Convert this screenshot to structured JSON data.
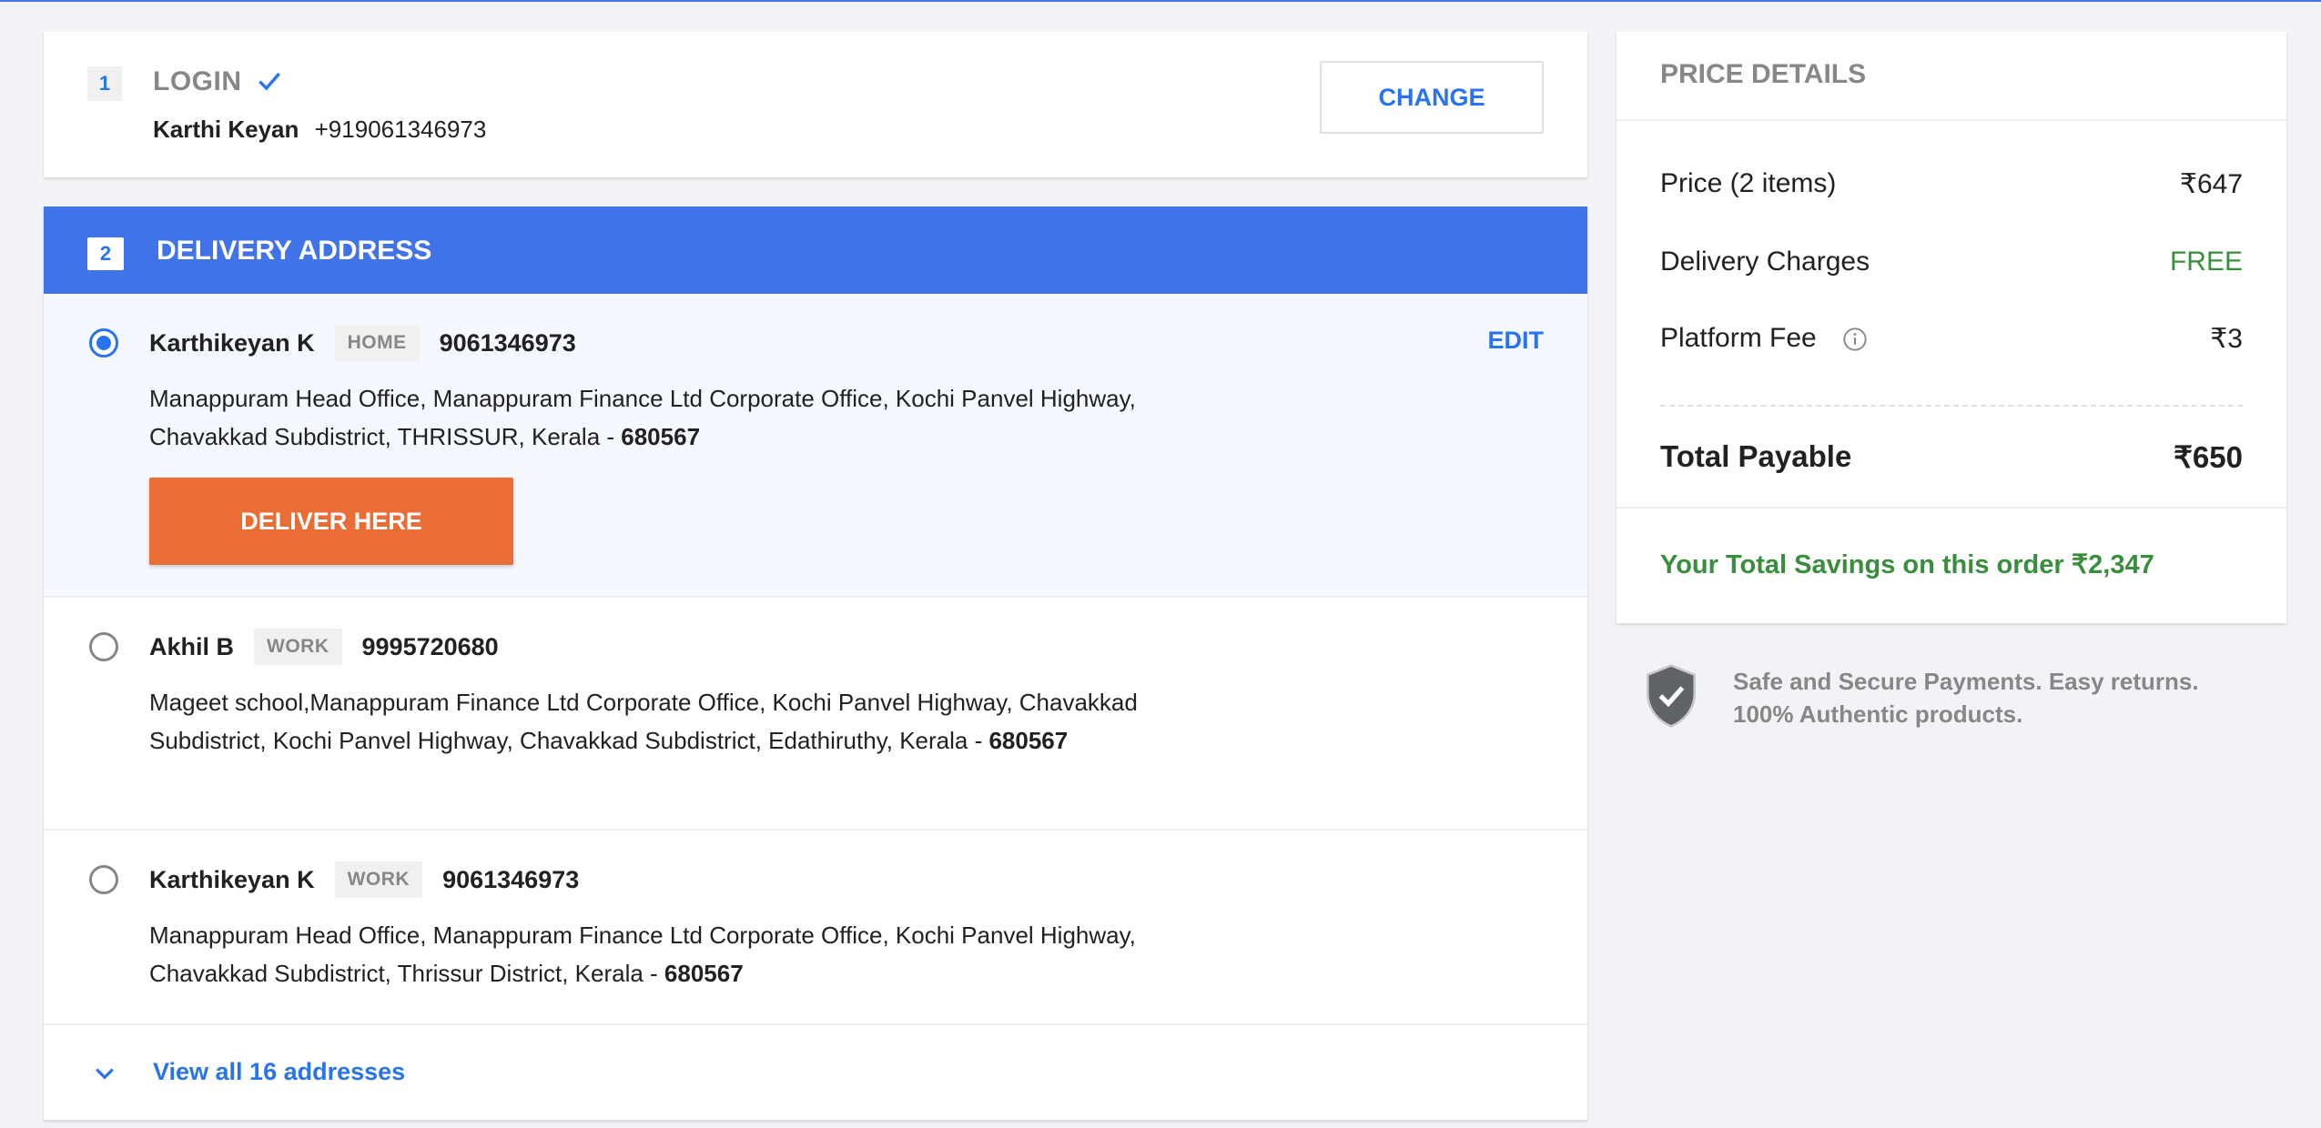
{
  "login": {
    "step": "1",
    "title": "LOGIN",
    "user_name": "Karthi Keyan",
    "user_phone": "+919061346973",
    "change_label": "CHANGE"
  },
  "delivery": {
    "step": "2",
    "title": "DELIVERY ADDRESS",
    "edit_label": "EDIT",
    "deliver_label": "DELIVER HERE",
    "addresses": [
      {
        "name": "Karthikeyan K",
        "tag": "HOME",
        "phone": "9061346973",
        "address": "Manappuram Head Office, Manappuram Finance Ltd Corporate Office, Kochi Panvel Highway, Chavakkad Subdistrict, THRISSUR, Kerala - ",
        "pincode": "680567",
        "selected": true
      },
      {
        "name": "Akhil B",
        "tag": "WORK",
        "phone": "9995720680",
        "address": "Mageet school,Manappuram Finance Ltd Corporate Office, Kochi Panvel Highway, Chavakkad Subdistrict, Kochi Panvel Highway, Chavakkad Subdistrict, Edathiruthy, Kerala - ",
        "pincode": "680567",
        "selected": false
      },
      {
        "name": "Karthikeyan K",
        "tag": "WORK",
        "phone": "9061346973",
        "address": "Manappuram Head Office, Manappuram Finance Ltd Corporate Office, Kochi Panvel Highway, Chavakkad Subdistrict, Thrissur District, Kerala - ",
        "pincode": "680567",
        "selected": false
      }
    ],
    "view_all_label": "View all 16 addresses"
  },
  "price_details": {
    "title": "PRICE DETAILS",
    "price_label": "Price (2 items)",
    "price_value": "₹647",
    "delivery_label": "Delivery Charges",
    "delivery_value": "FREE",
    "platform_label": "Platform Fee",
    "platform_value": "₹3",
    "total_label": "Total Payable",
    "total_value": "₹650",
    "savings": "Your Total Savings on this order ₹2,347"
  },
  "secure": {
    "text": "Safe and Secure Payments. Easy returns. 100% Authentic products."
  },
  "colors": {
    "accent": "#2874f0",
    "header_blue": "#4173e8",
    "deliver_orange": "#ea6d35",
    "savings_green": "#388e3c"
  }
}
